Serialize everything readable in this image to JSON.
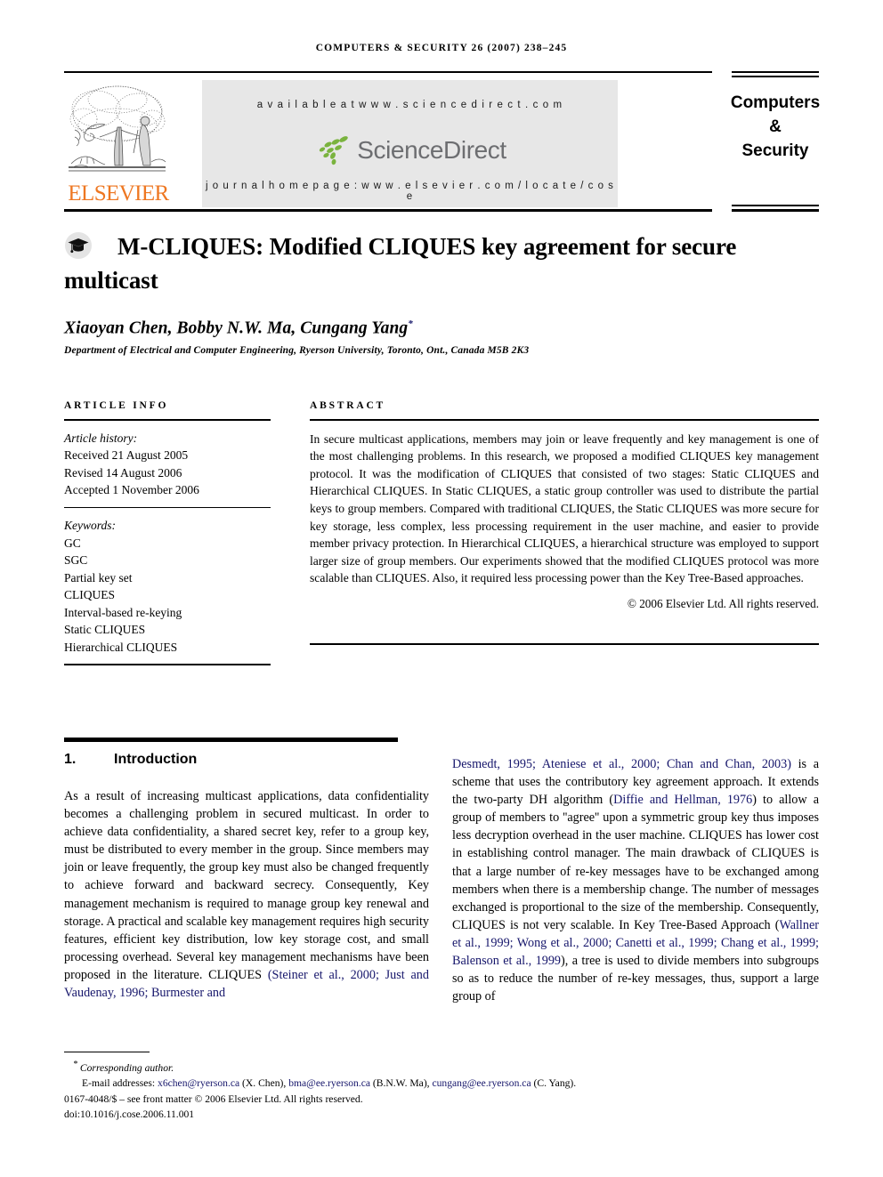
{
  "running_head": "Computers & Security 26 (2007) 238–245",
  "masthead": {
    "publisher_name": "ELSEVIER",
    "publisher_logo_icon": "elsevier-tree-logo",
    "available_at": "a v a i l a b l e   a t   w w w . s c i e n c e d i r e c t . c o m",
    "sciencedirect_wordmark": "ScienceDirect",
    "sciencedirect_logo_icon": "sciencedirect-leaves-icon",
    "journal_homepage": "j o u r n a l   h o m e p a g e :   w w w . e l s e v i e r . c o m / l o c a t e / c o s e",
    "journal_title_line1": "Computers",
    "journal_title_line2": "&",
    "journal_title_line3": "Security",
    "elsevier_orange": "#EE7722",
    "sciencedirect_green": "#7AB33E",
    "panel_gray": "#E7E7E7"
  },
  "article": {
    "title_icon": "graduation-cap-icon",
    "title": "M-CLIQUES: Modified CLIQUES key agreement for secure multicast",
    "authors": "Xiaoyan Chen, Bobby N.W. Ma, Cungang Yang",
    "author_footnote_marker": "*",
    "affiliation": "Department of Electrical and Computer Engineering, Ryerson University, Toronto, Ont., Canada M5B 2K3"
  },
  "article_info": {
    "heading": "ARTICLE INFO",
    "history_label": "Article history:",
    "history": [
      "Received 21 August 2005",
      "Revised 14 August 2006",
      "Accepted 1 November 2006"
    ],
    "keywords_label": "Keywords:",
    "keywords": [
      "GC",
      "SGC",
      "Partial key set",
      "CLIQUES",
      "Interval-based re-keying",
      "Static CLIQUES",
      "Hierarchical CLIQUES"
    ]
  },
  "abstract": {
    "heading": "ABSTRACT",
    "text": "In secure multicast applications, members may join or leave frequently and key management is one of the most challenging problems. In this research, we proposed a modified CLIQUES key management protocol. It was the modification of CLIQUES that consisted of two stages: Static CLIQUES and Hierarchical CLIQUES. In Static CLIQUES, a static group controller was used to distribute the partial keys to group members. Compared with traditional CLIQUES, the Static CLIQUES was more secure for key storage, less complex, less processing requirement in the user machine, and easier to provide member privacy protection. In Hierarchical CLIQUES, a hierarchical structure was employed to support larger size of group members. Our experiments showed that the modified CLIQUES protocol was more scalable than CLIQUES. Also, it required less processing power than the Key Tree-Based approaches.",
    "copyright": "© 2006 Elsevier Ltd. All rights reserved."
  },
  "section": {
    "number": "1.",
    "title": "Introduction"
  },
  "body": {
    "left_col_part1": "As a result of increasing multicast applications, data confidentiality becomes a challenging problem in secured multicast. In order to achieve data confidentiality, a shared secret key, refer to a group key, must be distributed to every member in the group. Since members may join or leave frequently, the group key must also be changed frequently to achieve forward and backward secrecy. Consequently, Key management mechanism is required to manage group key renewal and storage. A practical and scalable key management requires high security features, efficient key distribution, low key storage cost, and small processing overhead. Several key management mechanisms have been proposed in the literature. CLIQUES ",
    "left_col_cite1": "(Steiner et al., 2000; Just and Vaudenay, 1996; Burmester and",
    "right_col_cite1": "Desmedt, 1995; Ateniese et al., 2000; Chan and Chan, 2003)",
    "right_col_part1": " is a scheme that uses the contributory key agreement approach. It extends the two-party DH algorithm (",
    "right_col_cite2": "Diffie and Hellman, 1976",
    "right_col_part2": ") to allow a group of members to ''agree'' upon a symmetric group key thus imposes less decryption overhead in the user machine. CLIQUES has lower cost in establishing control manager. The main drawback of CLIQUES is that a large number of re-key messages have to be exchanged among members when there is a membership change. The number of messages exchanged is proportional to the size of the membership. Consequently, CLIQUES is not very scalable. In Key Tree-Based Approach (",
    "right_col_cite3": "Wallner et al., 1999; Wong et al., 2000; Canetti et al., 1999; Chang et al., 1999; Balenson et al., 1999",
    "right_col_part3": "), a tree is used to divide members into subgroups so as to reduce the number of re-key messages, thus, support a large group of"
  },
  "footer": {
    "corresponding_marker": "*",
    "corresponding_author": "Corresponding author.",
    "email_label": "E-mail addresses:",
    "email1": "x6chen@ryerson.ca",
    "email1_owner": "(X. Chen),",
    "email2": "bma@ee.ryerson.ca",
    "email2_owner": "(B.N.W. Ma),",
    "email3": "cungang@ee.ryerson.ca",
    "email3_owner": "(C. Yang).",
    "issn_line": "0167-4048/$ – see front matter © 2006 Elsevier Ltd. All rights reserved.",
    "doi_line": "doi:10.1016/j.cose.2006.11.001"
  }
}
